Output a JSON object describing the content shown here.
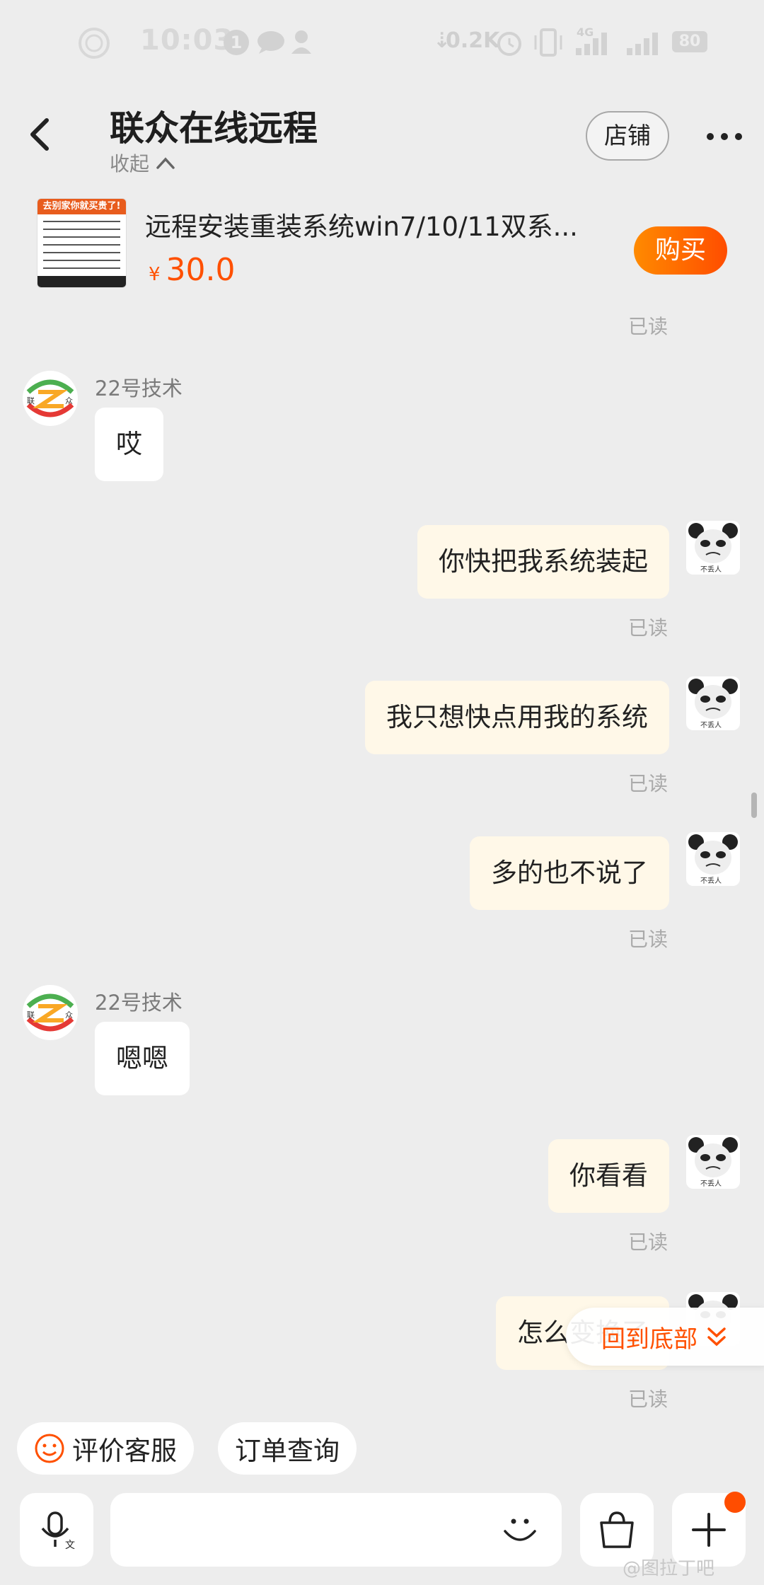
{
  "status_bar": {
    "time": "10:03",
    "notification_count": "1",
    "net_speed": "0.2K",
    "network_label": "4G",
    "battery": "80"
  },
  "header": {
    "title": "联众在线远程",
    "collapse_label": "收起",
    "shop_button": "店铺"
  },
  "product": {
    "title": "远程安装重装系统win7/10/11双系...",
    "currency": "¥",
    "price": "30.0",
    "buy_button": "购买",
    "thumb_banner": "去别家你就买贵了!"
  },
  "read_label": "已读",
  "messages": [
    {
      "side": "left",
      "sender": "22号技术",
      "text": "哎"
    },
    {
      "side": "right",
      "text": "你快把我系统装起",
      "status": "已读"
    },
    {
      "side": "right",
      "text": "我只想快点用我的系统",
      "status": "已读"
    },
    {
      "side": "right",
      "text": "多的也不说了",
      "status": "已读"
    },
    {
      "side": "left",
      "sender": "22号技术",
      "text": "嗯嗯"
    },
    {
      "side": "right",
      "text": "你看看",
      "status": "已读"
    },
    {
      "side": "right",
      "text": "怎么变换了",
      "status": "已读"
    }
  ],
  "my_avatar_caption": "不丢人",
  "shop_avatar_labels": [
    "联",
    "众"
  ],
  "back_to_bottom": "回到底部",
  "quick_replies": [
    "评价客服",
    "订单查询"
  ],
  "input": {
    "placeholder": ""
  },
  "watermark": "@图拉丁吧",
  "colors": {
    "accent": "#ff5000",
    "background": "#ededed",
    "my_bubble": "#fff8e8"
  }
}
